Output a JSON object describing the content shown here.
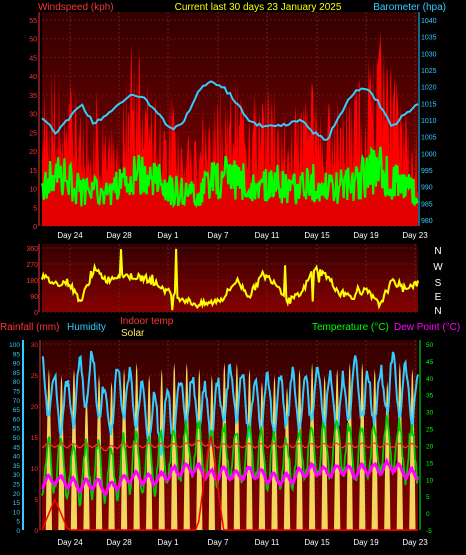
{
  "header": {
    "left_label": "Windspeed (kph)",
    "center_label": "Current last 30 days 23 January 2025",
    "right_label": "Barometer (hpa)"
  },
  "wind_panel_legend": {
    "rainfall": "Rainfall (mm)",
    "humidity": "Humidity",
    "indoor_temp": "Indoor temp",
    "solar": "Solar",
    "temperature": "Temperature (°C)",
    "dew_point": "Dew Point (°C)"
  },
  "direction_labels": [
    "N",
    "W",
    "S",
    "E",
    "N"
  ],
  "date_labels": [
    "Day 24",
    "Day 28",
    "Day 1",
    "Day 7",
    "Day 11",
    "Day 15",
    "Day 19",
    "Day 23"
  ],
  "colors": {
    "background": "#000000",
    "panel_top": "#330000",
    "panel_bottom": "#880000",
    "wind_gust": "#ff0000",
    "wind_avg": "#00ff00",
    "barometer": "#33ccff",
    "direction": "#ffff00",
    "humidity": "#33ccff",
    "temperature": "#00cc00",
    "dew_point": "#ff00ff",
    "indoor_temp": "#ff3333",
    "solar": "#ffee66",
    "rainfall": "#ff0000",
    "axis_left": "#ff3333",
    "axis_right": "#33ccff",
    "axis_temp": "#00ff00",
    "date_text": "#ffffff",
    "header_center": "#ffff00"
  },
  "chart_data": [
    {
      "type": "line",
      "name": "wind-barometer",
      "days": 30,
      "left_axis": {
        "label": "Windspeed (kph)",
        "ylim": [
          0,
          55
        ],
        "ticks": [
          0,
          5,
          10,
          15,
          20,
          25,
          30,
          35,
          40,
          45,
          50,
          55
        ]
      },
      "right_axis": {
        "label": "Barometer (hpa)",
        "ylim": [
          980,
          1040
        ],
        "ticks": [
          980,
          985,
          990,
          995,
          1000,
          1005,
          1010,
          1015,
          1020,
          1025,
          1030,
          1035,
          1040
        ]
      },
      "series": [
        {
          "name": "Windspeed",
          "key": "gust",
          "values": [
            30,
            35,
            32,
            28,
            34,
            20,
            25,
            44,
            32,
            30,
            28,
            25,
            22,
            30,
            34,
            32,
            30,
            28,
            35,
            24,
            30,
            32,
            26,
            28,
            30,
            34,
            45,
            35,
            25,
            20
          ]
        },
        {
          "name": "Windspeed",
          "key": "avg",
          "values": [
            12,
            15,
            14,
            10,
            12,
            9,
            12,
            16,
            14,
            13,
            11,
            10,
            10,
            13,
            15,
            14,
            12,
            11,
            14,
            10,
            12,
            13,
            11,
            12,
            13,
            15,
            17,
            14,
            12,
            10
          ]
        },
        {
          "name": "Barometer",
          "key": "pressure",
          "values": [
            1011,
            1006,
            1010,
            1015,
            1009,
            1011,
            1015,
            1018,
            1016,
            1012,
            1007,
            1010,
            1018,
            1022,
            1020,
            1015,
            1010,
            1008,
            1008,
            1009,
            1010,
            1006,
            1004,
            1012,
            1018,
            1020,
            1015,
            1008,
            1012,
            1015
          ]
        }
      ]
    },
    {
      "type": "line",
      "name": "wind-direction",
      "days": 30,
      "ylim": [
        0,
        360
      ],
      "ticks": [
        0,
        90,
        180,
        270,
        360
      ],
      "series": [
        {
          "name": "Direction",
          "values": [
            200,
            160,
            170,
            60,
            240,
            180,
            210,
            200,
            190,
            150,
            100,
            70,
            40,
            50,
            80,
            180,
            90,
            210,
            170,
            60,
            100,
            250,
            200,
            100,
            90,
            120,
            40,
            170,
            140,
            160
          ]
        }
      ]
    },
    {
      "type": "line",
      "name": "temperature-humidity",
      "days": 30,
      "left_axis": {
        "label": "Rainfall (mm)",
        "ylim": [
          0,
          100
        ],
        "ticks": [
          0,
          5,
          10,
          15,
          20,
          25,
          30,
          35,
          40,
          45,
          50,
          55,
          60,
          65,
          70,
          75,
          80,
          85,
          90,
          95,
          100
        ]
      },
      "rain_axis": {
        "ylim": [
          0,
          30
        ],
        "ticks": [
          0,
          5,
          10,
          15,
          20,
          25,
          30
        ]
      },
      "right_axis": {
        "label": "Temperature (°C)",
        "ylim": [
          -5,
          50
        ],
        "ticks": [
          -5,
          0,
          5,
          10,
          15,
          20,
          25,
          30,
          35,
          40,
          45,
          50
        ]
      },
      "series": [
        {
          "name": "Humidity",
          "key": "humidity",
          "values": [
            80,
            70,
            65,
            78,
            82,
            60,
            75,
            70,
            65,
            55,
            62,
            70,
            68,
            60,
            72,
            74,
            65,
            70,
            66,
            72,
            68,
            75,
            70,
            66,
            78,
            70,
            72,
            80,
            74,
            70
          ]
        },
        {
          "name": "Temperature (°C)",
          "key": "temp",
          "values": [
            12,
            15,
            13,
            11,
            14,
            10,
            13,
            16,
            14,
            15,
            17,
            18,
            19,
            16,
            18,
            17,
            18,
            16,
            15,
            14,
            17,
            19,
            18,
            20,
            17,
            18,
            19,
            20,
            18,
            17
          ]
        },
        {
          "name": "Dew Point (°C)",
          "key": "dew",
          "values": [
            9,
            10,
            9,
            8,
            9,
            7,
            9,
            11,
            10,
            10,
            12,
            13,
            13,
            11,
            12,
            11,
            12,
            11,
            10,
            10,
            12,
            13,
            12,
            13,
            12,
            13,
            13,
            14,
            12,
            11
          ]
        },
        {
          "name": "Indoor temp",
          "key": "indoor",
          "values": [
            20,
            20,
            20,
            20,
            20,
            19,
            20,
            20,
            20,
            20,
            20,
            20,
            21,
            20,
            20,
            20,
            20,
            20,
            20,
            20,
            20,
            20,
            20,
            20,
            20,
            20,
            20,
            20,
            20,
            20
          ]
        },
        {
          "name": "Solar",
          "key": "solar_peak",
          "values": [
            26,
            25,
            26,
            22,
            25,
            24,
            26,
            27,
            25,
            26,
            27,
            27,
            26,
            25,
            27,
            27,
            26,
            24,
            25,
            23,
            26,
            27,
            25,
            26,
            27,
            27,
            26,
            24,
            27,
            26
          ]
        },
        {
          "name": "Rainfall (mm)",
          "key": "rain",
          "values": [
            0,
            5,
            0,
            0,
            0,
            0,
            0,
            0,
            0,
            0,
            0,
            0,
            0,
            16,
            0,
            0,
            0,
            0,
            0,
            0,
            0,
            0,
            0,
            0,
            0,
            0,
            0,
            0,
            0,
            0
          ]
        }
      ]
    }
  ]
}
